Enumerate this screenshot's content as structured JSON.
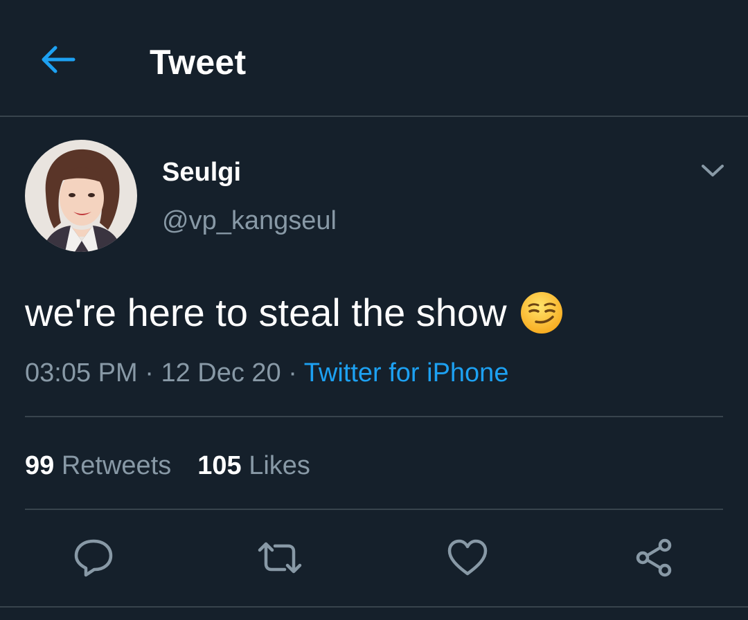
{
  "header": {
    "title": "Tweet",
    "back_icon": "arrow-left-icon"
  },
  "author": {
    "display_name": "Seulgi",
    "handle": "@vp_kangseul",
    "avatar": "profile-photo"
  },
  "tweet": {
    "text": "we're here to steal the show",
    "emoji": "smirking-face",
    "time": "03:05 PM",
    "separator": " · ",
    "date": "12 Dec 20",
    "source": "Twitter for iPhone"
  },
  "stats": {
    "retweets_count": "99",
    "retweets_label": "Retweets",
    "likes_count": "105",
    "likes_label": "Likes"
  },
  "actions": [
    {
      "name": "reply",
      "icon": "speech-bubble-icon"
    },
    {
      "name": "retweet",
      "icon": "retweet-icon"
    },
    {
      "name": "like",
      "icon": "heart-icon"
    },
    {
      "name": "share",
      "icon": "share-icon"
    }
  ],
  "colors": {
    "background": "#15202b",
    "accent": "#1da1f2",
    "secondary_text": "#8899a6",
    "divider": "#38444d"
  }
}
